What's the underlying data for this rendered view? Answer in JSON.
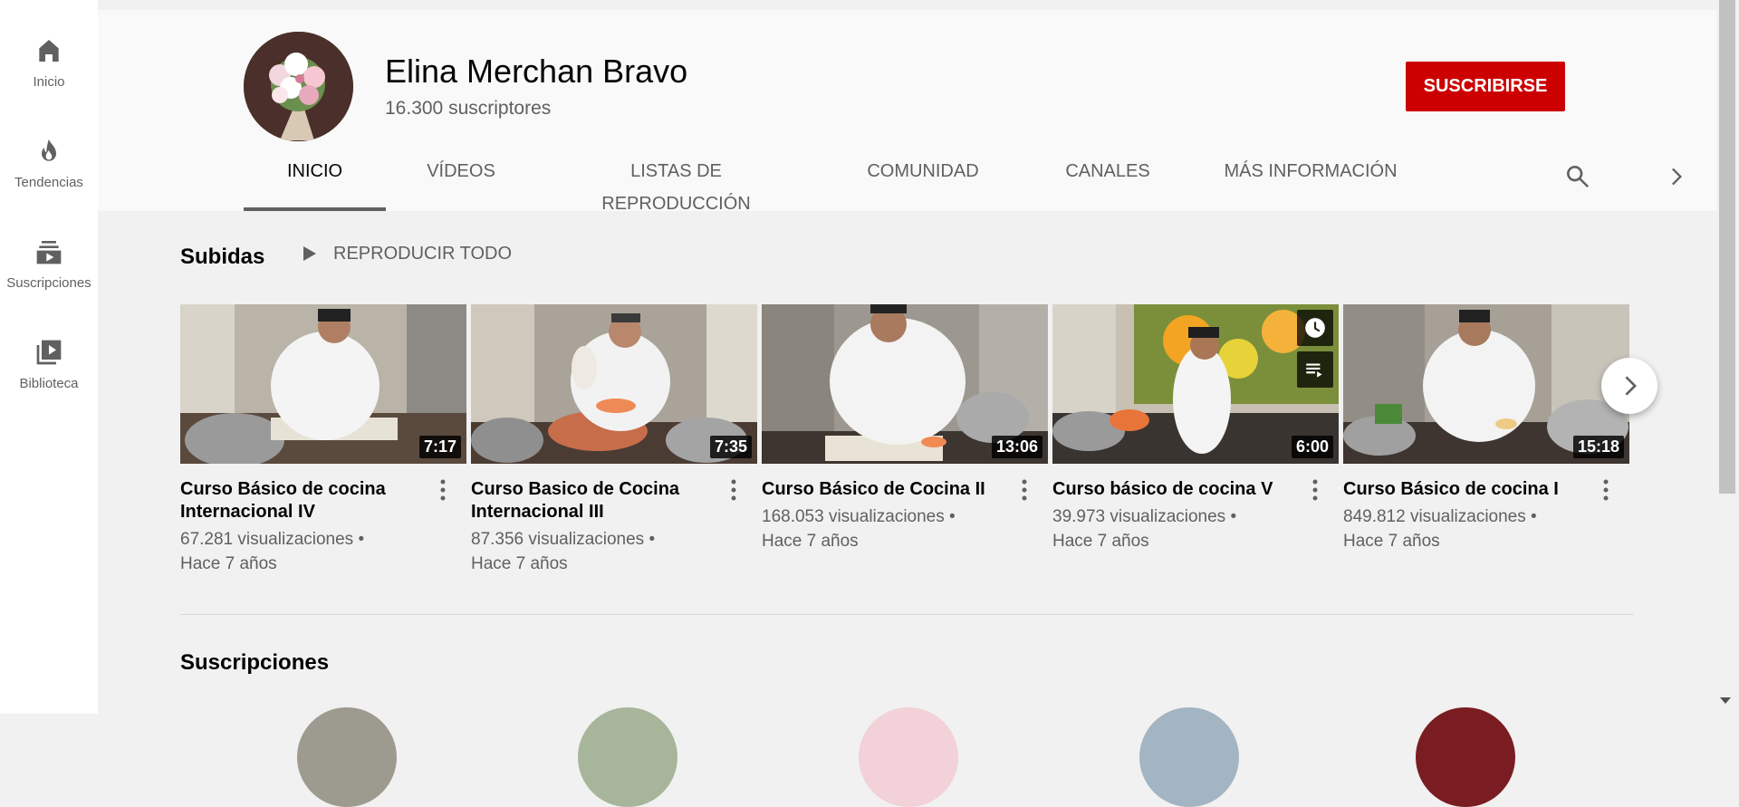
{
  "sidebar": {
    "items": [
      {
        "label": "Inicio",
        "icon": "home-icon"
      },
      {
        "label": "Tendencias",
        "icon": "flame-icon"
      },
      {
        "label": "Suscripciones",
        "icon": "subscriptions-icon"
      },
      {
        "label": "Biblioteca",
        "icon": "library-icon"
      }
    ]
  },
  "channel": {
    "name": "Elina Merchan Bravo",
    "subscribers": "16.300 suscriptores",
    "subscribe_label": "SUSCRIBIRSE"
  },
  "tabs": [
    "INICIO",
    "VÍDEOS",
    "LISTAS DE REPRODUCCIÓN",
    "COMUNIDAD",
    "CANALES",
    "MÁS INFORMACIÓN"
  ],
  "uploads": {
    "title": "Subidas",
    "play_all_label": "REPRODUCIR TODO",
    "videos": [
      {
        "title": "Curso Básico de cocina Internacional IV",
        "duration": "7:17",
        "views": "67.281 visualizaciones •",
        "age": "Hace 7 años"
      },
      {
        "title": "Curso Basico de Cocina Internacional III",
        "duration": "7:35",
        "views": "87.356 visualizaciones •",
        "age": "Hace 7 años"
      },
      {
        "title": "Curso Básico de Cocina II",
        "duration": "13:06",
        "views": "168.053 visualizaciones •",
        "age": "Hace 7 años"
      },
      {
        "title": "Curso básico de cocina V",
        "duration": "6:00",
        "views": "39.973 visualizaciones •",
        "age": "Hace 7 años"
      },
      {
        "title": "Curso Básico de cocina I",
        "duration": "15:18",
        "views": "849.812 visualizaciones •",
        "age": "Hace 7 años"
      }
    ]
  },
  "subscriptions": {
    "title": "Suscripciones"
  },
  "colors": {
    "accent": "#cc0000",
    "text_secondary": "#606060"
  }
}
